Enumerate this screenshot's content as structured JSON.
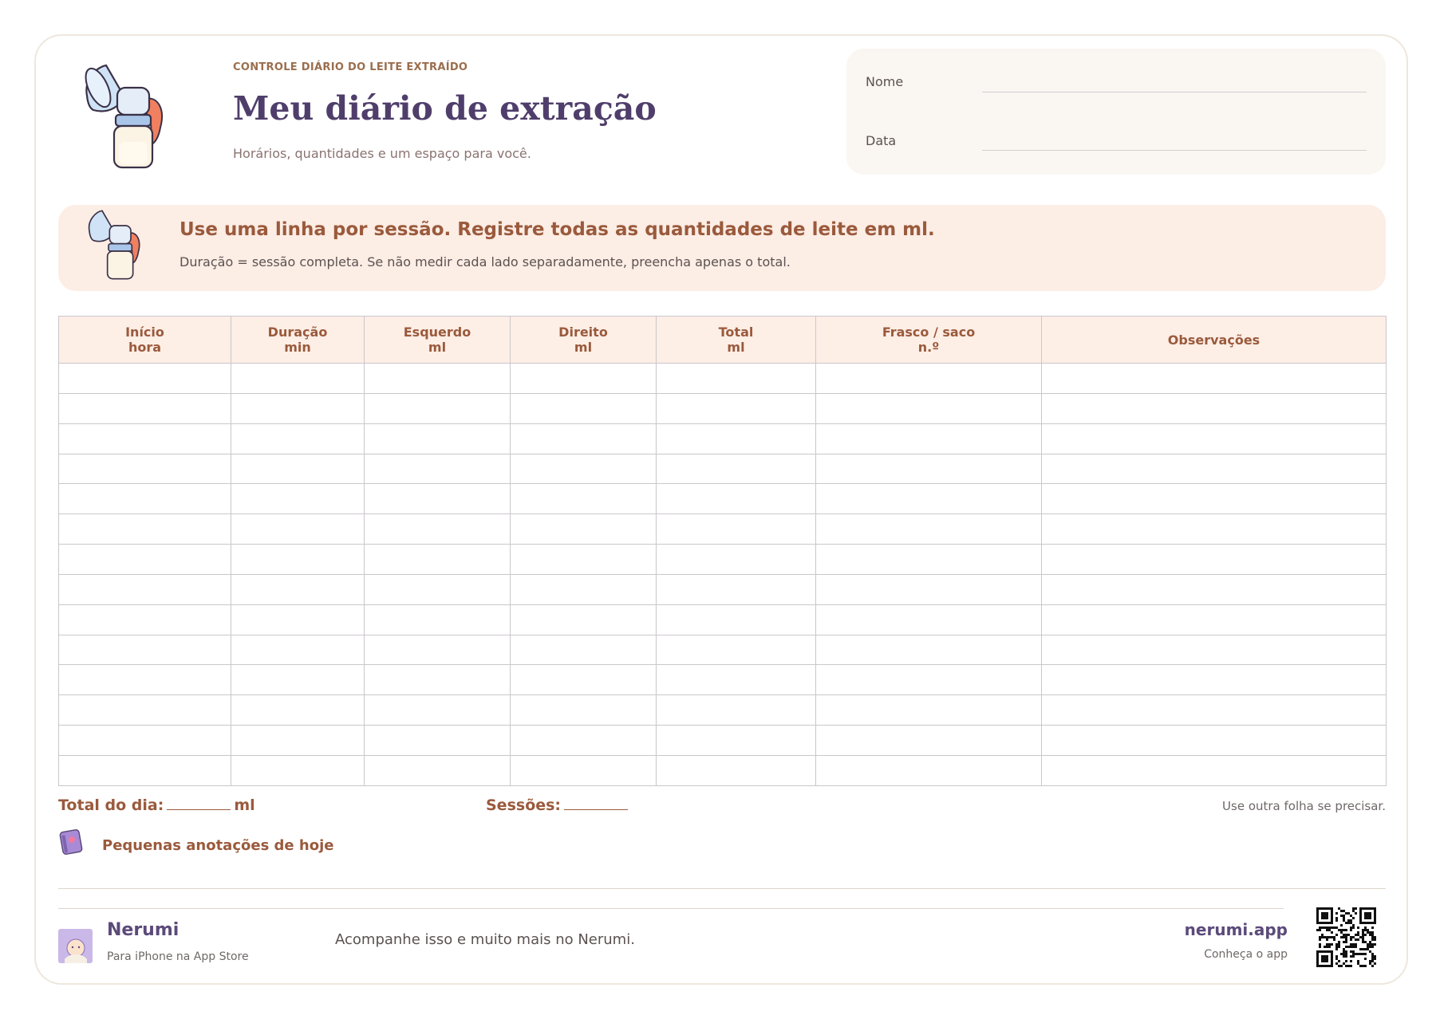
{
  "header": {
    "kicker": "CONTROLE DIÁRIO DO LEITE EXTRAÍDO",
    "title": "Meu diário de extração",
    "subtitle": "Horários, quantidades e um espaço para você."
  },
  "name_card": {
    "name_label": "Nome",
    "date_label": "Data"
  },
  "banner": {
    "heading": "Use uma linha por sessão. Registre todas as quantidades de leite em ml.",
    "text": "Duração = sessão completa. Se não medir cada lado separadamente, preencha apenas o total."
  },
  "table": {
    "columns": [
      {
        "line1": "Início",
        "line2": "hora"
      },
      {
        "line1": "Duração",
        "line2": "min"
      },
      {
        "line1": "Esquerdo",
        "line2": "ml"
      },
      {
        "line1": "Direito",
        "line2": "ml"
      },
      {
        "line1": "Total",
        "line2": "ml"
      },
      {
        "line1": "Frasco / saco",
        "line2": "n.º"
      },
      {
        "line1": "Observações",
        "line2": ""
      }
    ],
    "row_count": 14
  },
  "totals": {
    "total_day_label": "Total do dia:",
    "total_day_unit": "ml",
    "sessions_label": "Sessões:",
    "note": "Use outra folha se precisar."
  },
  "notes": {
    "title": "Pequenas anotações de hoje"
  },
  "footer": {
    "brand_name": "Nerumi",
    "brand_sub": "Para iPhone na App Store",
    "promo": "Acompanhe isso e muito mais no Nerumi.",
    "site": "nerumi.app",
    "site_sub": "Conheça o app"
  },
  "icons": {
    "header": "breast-pump-icon",
    "banner": "breast-pump-icon",
    "notes": "notebook-icon",
    "brand": "baby-avatar-icon",
    "qr": "qr-code"
  },
  "colors": {
    "title": "#4f3e6b",
    "accent": "#9a5a3c",
    "banner_bg": "#fcede5",
    "header_bg": "#fdeee6"
  }
}
